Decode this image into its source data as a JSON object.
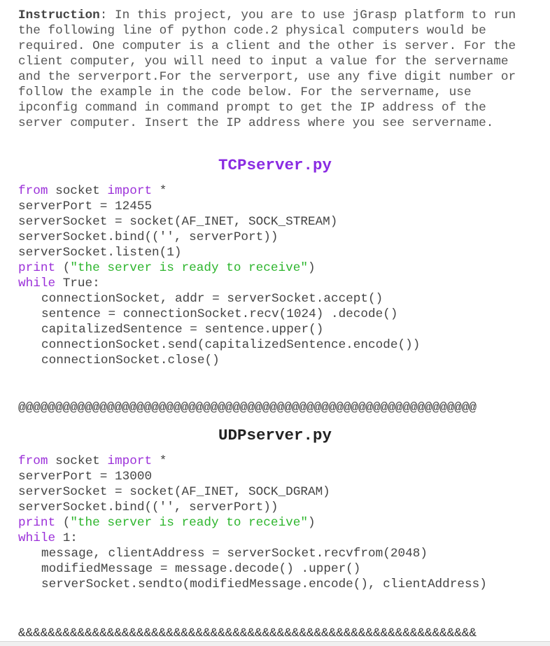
{
  "instruction": {
    "label": "Instruction",
    "text": ": In this project, you are to use jGrasp platform to run the following line of python code.2 physical computers would be required. One computer is a client and the other is server. For the client computer, you will need to input a value for the servername and the serverport.For the serverport, use any five digit number or follow the example in the code below. For the servername, use ipconfig command in command prompt to get the IP address of the server computer. Insert the IP address where you see servername."
  },
  "tcp": {
    "title": "TCPserver.py",
    "lines": [
      {
        "kw1": "from",
        "mid": " socket ",
        "kw2": "import",
        "rest": " *"
      },
      {
        "text": "serverPort = 12455"
      },
      {
        "text": "serverSocket = socket(AF_INET, SOCK_STREAM)"
      },
      {
        "text": "serverSocket.bind(('', serverPort))"
      },
      {
        "text": "serverSocket.listen(1)"
      },
      {
        "kw": "print",
        "pre": " (",
        "str": "\"the server is ready to receive\"",
        "post": ")"
      },
      {
        "kw": "while",
        "rest": " True:"
      },
      {
        "text": "connectionSocket, addr = serverSocket.accept()"
      },
      {
        "text": "sentence = connectionSocket.recv(1024) .decode()"
      },
      {
        "text": "capitalizedSentence = sentence.upper()"
      },
      {
        "text": "connectionSocket.send(capitalizedSentence.encode())"
      },
      {
        "text": "connectionSocket.close()"
      }
    ]
  },
  "separator_at": "@@@@@@@@@@@@@@@@@@@@@@@@@@@@@@@@@@@@@@@@@@@@@@@@@@@@@@@@@@@@@@",
  "udp": {
    "title": "UDPserver.py",
    "lines": [
      {
        "kw1": "from",
        "mid": " socket ",
        "kw2": "import",
        "rest": " *"
      },
      {
        "text": "serverPort = 13000"
      },
      {
        "text": "serverSocket = socket(AF_INET, SOCK_DGRAM)"
      },
      {
        "text": "serverSocket.bind(('', serverPort))"
      },
      {
        "kw": "print",
        "pre": " (",
        "str": "\"the server is ready to receive\"",
        "post": ")"
      },
      {
        "kw": "while",
        "rest": " 1:"
      },
      {
        "text": "message, clientAddress = serverSocket.recvfrom(2048)"
      },
      {
        "text": "modifiedMessage = message.decode() .upper()"
      },
      {
        "text": "serverSocket.sendto(modifiedMessage.encode(), clientAddress)"
      }
    ]
  },
  "separator_amp": "&&&&&&&&&&&&&&&&&&&&&&&&&&&&&&&&&&&&&&&&&&&&&&&&&&&&&&&&&&&&&&",
  "colors": {
    "keyword": "#9b30d9",
    "string": "#2db52d",
    "tcp_title": "#8a2be2",
    "text": "#444444"
  }
}
